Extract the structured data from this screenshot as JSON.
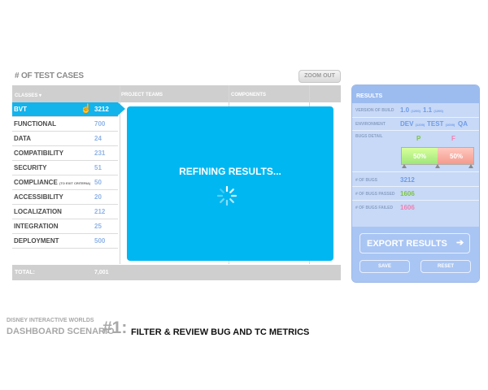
{
  "section_title": "# OF TEST CASES",
  "zoom_button": "ZOOM OUT",
  "table": {
    "headers": {
      "classes": "CLASSES",
      "teams": "PROJECT TEAMS",
      "components": "COMPONENTS"
    },
    "rows": [
      {
        "label": "BVT",
        "value": "3212",
        "active": true
      },
      {
        "label": "FUNCTIONAL",
        "value": "700"
      },
      {
        "label": "DATA",
        "value": "24"
      },
      {
        "label": "COMPATIBILITY",
        "value": "231"
      },
      {
        "label": "SECURITY",
        "value": "51"
      },
      {
        "label": "COMPLIANCE",
        "note": "(TO EXIT CRITERIA)",
        "value": "50"
      },
      {
        "label": "ACCESSIBILITY",
        "value": "20"
      },
      {
        "label": "LOCALIZATION",
        "value": "212"
      },
      {
        "label": "INTEGRATION",
        "value": "25"
      },
      {
        "label": "DEPLOYMENT",
        "value": "500"
      }
    ],
    "total_label": "TOTAL:",
    "total_value": "7,001"
  },
  "overlay": {
    "message": "REFINING RESULTS..."
  },
  "results": {
    "title": "RESULTS",
    "version_label": "VERSION OF BUILD",
    "version_1": "1.0",
    "version_1_sub": "(1200)",
    "version_2": "1.1",
    "version_2_sub": "(1200)",
    "environment_label": "ENVIRONMENT",
    "env_1": "DEV",
    "env_1_sub": "(1200)",
    "env_2": "TEST",
    "env_2_sub": "(1000)",
    "env_3": "QA",
    "bugs_detail_label": "BUGS DETAIL",
    "pass_letter": "P",
    "fail_letter": "F",
    "pass_pct": "50%",
    "fail_pct": "50%",
    "pass_fraction": 0.5,
    "num_bugs_label": "# OF BUGS",
    "num_bugs": "3212",
    "bugs_passed_label": "# OF BUGS PASSED",
    "bugs_passed": "1606",
    "bugs_failed_label": "# OF BUGS FAILED",
    "bugs_failed": "1606",
    "export_label": "EXPORT RESULTS",
    "save_label": "SAVE",
    "reset_label": "RESET"
  },
  "caption": {
    "line1": "DISNEY INTERACTIVE WORLDS",
    "line2": "DASHBOARD SCENARIO",
    "number": "#1:",
    "line3": "FILTER & REVIEW BUG AND TC METRICS"
  },
  "colors": {
    "accent": "#00b7f1",
    "pass": "#7dc443",
    "fail": "#f27fb2",
    "value_blue": "#6f9be8"
  }
}
